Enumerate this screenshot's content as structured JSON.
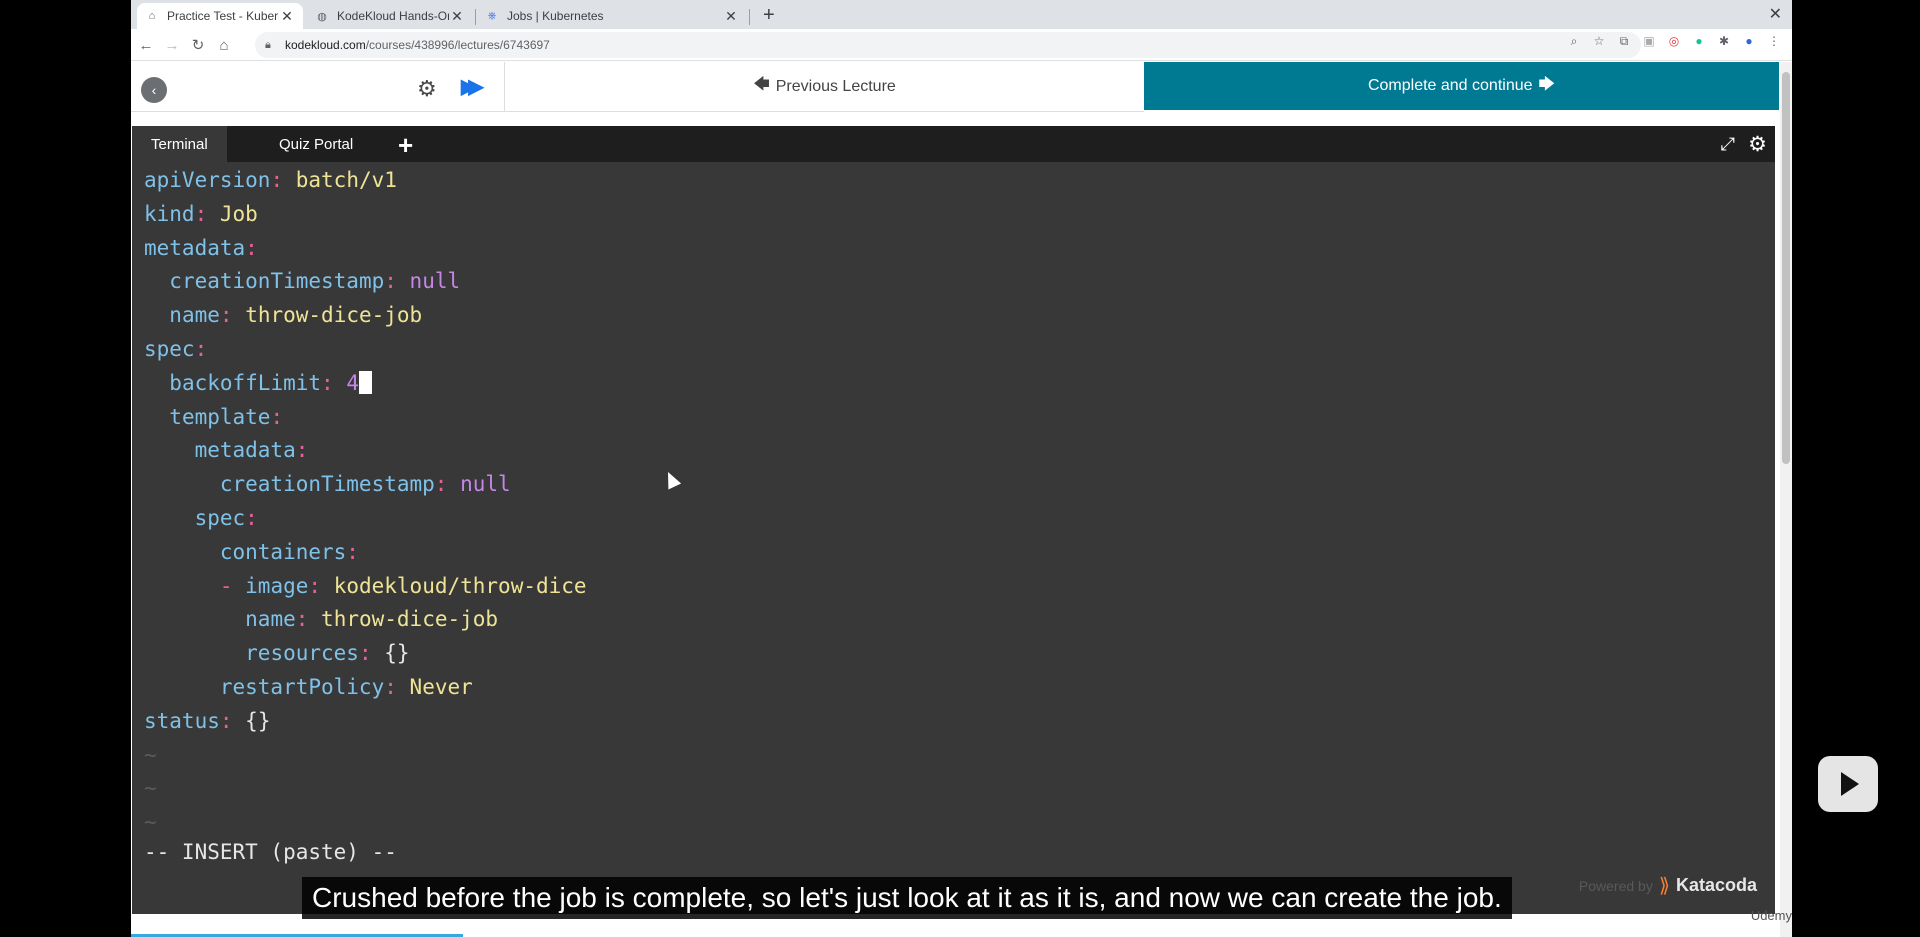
{
  "browser": {
    "tabs": [
      {
        "title": "Practice Test - Kubernetes - C",
        "favicon": "kodekloud-icon",
        "active": true
      },
      {
        "title": "KodeKloud Hands-On Quiz",
        "favicon": "globe-icon",
        "active": false
      },
      {
        "title": "Jobs | Kubernetes",
        "favicon": "kubernetes-icon",
        "active": false
      }
    ],
    "new_tab": "+",
    "close_window": "✕",
    "url_host": "kodekloud.com",
    "url_path": "/courses/438996/lectures/6743697"
  },
  "course_nav": {
    "previous_label": "Previous Lecture",
    "complete_label": "Complete and continue"
  },
  "terminal": {
    "tabs": [
      "Terminal",
      "Quiz Portal"
    ],
    "add_tab": "+",
    "status_line": "-- INSERT (paste) --",
    "lines": [
      {
        "indent": "",
        "dash": false,
        "key": "apiVersion",
        "value": "batch/v1",
        "value_type": "string"
      },
      {
        "indent": "",
        "dash": false,
        "key": "kind",
        "value": "Job",
        "value_type": "string"
      },
      {
        "indent": "",
        "dash": false,
        "key": "metadata",
        "value": "",
        "value_type": "none"
      },
      {
        "indent": "  ",
        "dash": false,
        "key": "creationTimestamp",
        "value": "null",
        "value_type": "null"
      },
      {
        "indent": "  ",
        "dash": false,
        "key": "name",
        "value": "throw-dice-job",
        "value_type": "string"
      },
      {
        "indent": "",
        "dash": false,
        "key": "spec",
        "value": "",
        "value_type": "none"
      },
      {
        "indent": "  ",
        "dash": false,
        "key": "backoffLimit",
        "value": "4",
        "value_type": "number",
        "cursor": true
      },
      {
        "indent": "  ",
        "dash": false,
        "key": "template",
        "value": "",
        "value_type": "none"
      },
      {
        "indent": "    ",
        "dash": false,
        "key": "metadata",
        "value": "",
        "value_type": "none"
      },
      {
        "indent": "      ",
        "dash": false,
        "key": "creationTimestamp",
        "value": "null",
        "value_type": "null"
      },
      {
        "indent": "    ",
        "dash": false,
        "key": "spec",
        "value": "",
        "value_type": "none"
      },
      {
        "indent": "      ",
        "dash": false,
        "key": "containers",
        "value": "",
        "value_type": "none"
      },
      {
        "indent": "      ",
        "dash": true,
        "key": "image",
        "value": "kodekloud/throw-dice",
        "value_type": "string"
      },
      {
        "indent": "        ",
        "dash": false,
        "key": "name",
        "value": "throw-dice-job",
        "value_type": "string"
      },
      {
        "indent": "        ",
        "dash": false,
        "key": "resources",
        "value": "{}",
        "value_type": "brace"
      },
      {
        "indent": "      ",
        "dash": false,
        "key": "restartPolicy",
        "value": "Never",
        "value_type": "string"
      },
      {
        "indent": "",
        "dash": false,
        "key": "status",
        "value": "{}",
        "value_type": "brace"
      }
    ],
    "tilde_lines": [
      "~",
      "~",
      "~"
    ]
  },
  "branding": {
    "powered_by": "Powered by",
    "katacoda": "Katacoda",
    "udemy": "Udemy"
  },
  "subtitle": "Crushed before the job is complete, so let's just look at it as it is, and now we can create the job.",
  "video_progress_percent": 20,
  "colors": {
    "complete_button": "#007a92",
    "terminal_bg": "#383838",
    "yaml_key": "#7fc1e8",
    "yaml_punct": "#e8609a",
    "yaml_string": "#efe496",
    "yaml_null": "#c586e8"
  }
}
